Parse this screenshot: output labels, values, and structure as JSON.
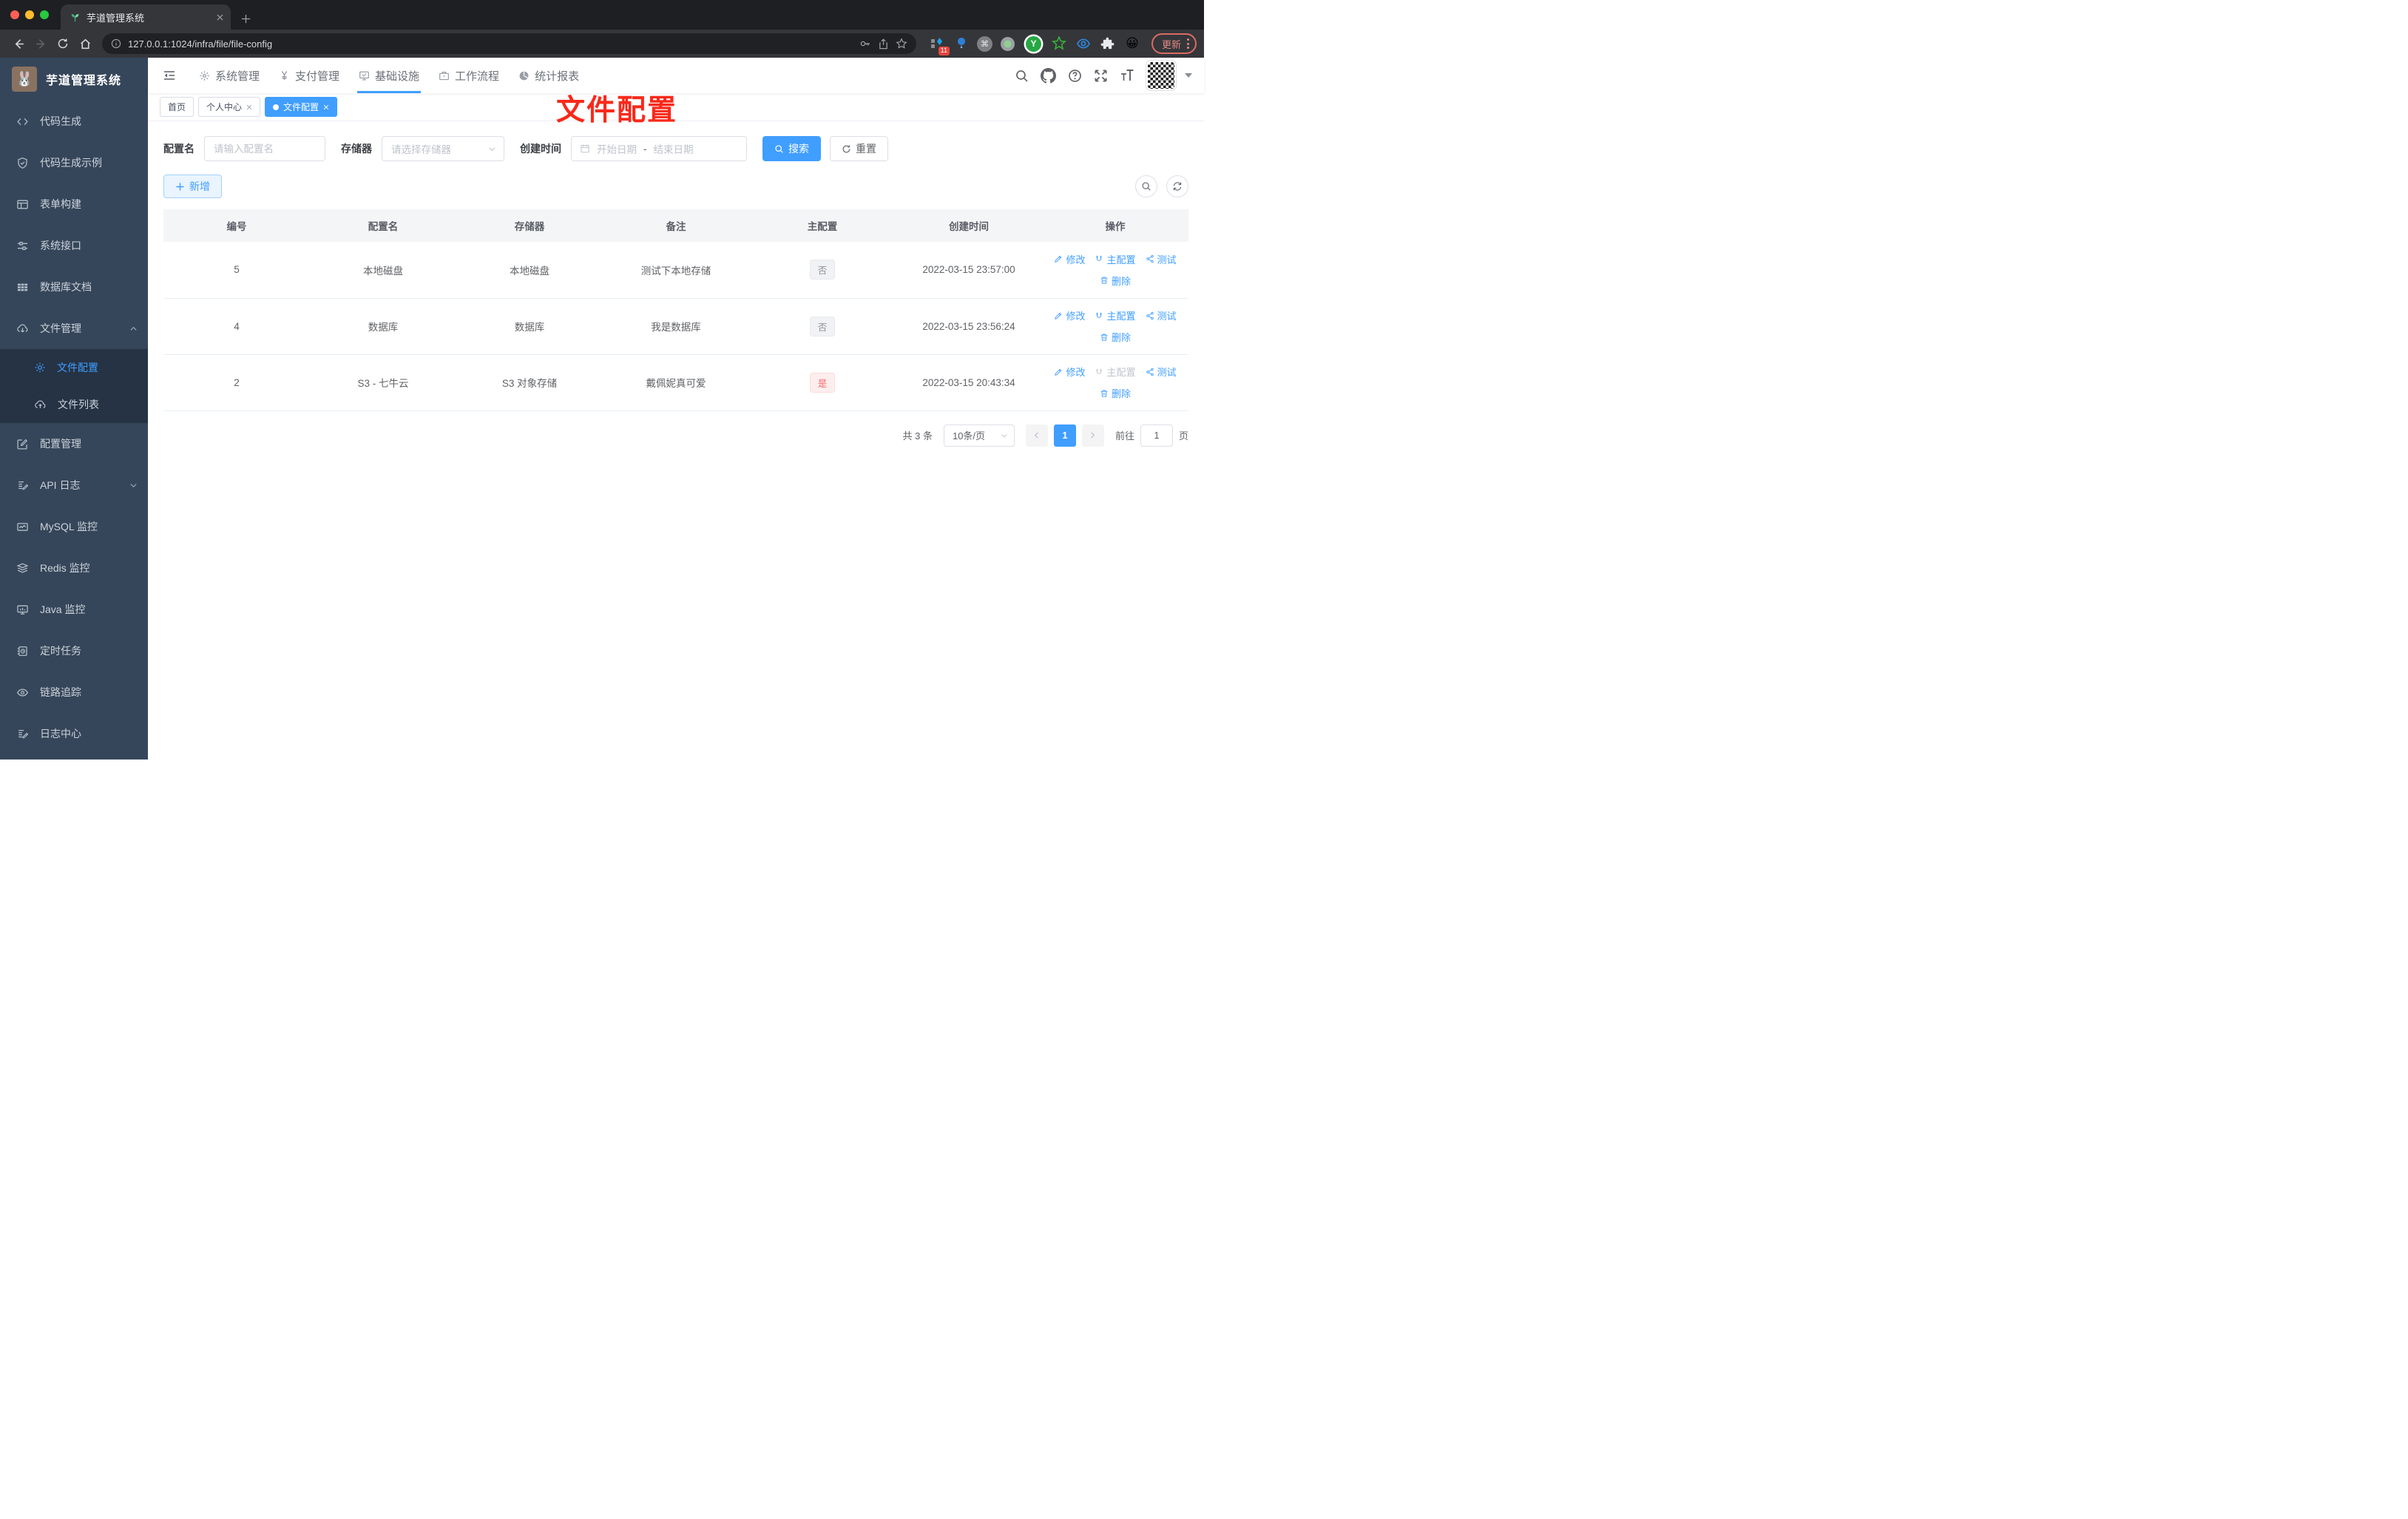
{
  "browser": {
    "tab_title": "芋道管理系统",
    "url": "127.0.0.1:1024/infra/file/file-config",
    "extension_badge": "11",
    "extension_y_label": "Y",
    "extension_emoji": "😀",
    "update_label": "更新"
  },
  "sidebar": {
    "title": "芋道管理系统",
    "logo_emoji": "🐰",
    "items": [
      {
        "label": "代码生成",
        "icon": "code-icon"
      },
      {
        "label": "代码生成示例",
        "icon": "shield-check-icon"
      },
      {
        "label": "表单构建",
        "icon": "form-icon"
      },
      {
        "label": "系统接口",
        "icon": "sliders-icon"
      },
      {
        "label": "数据库文档",
        "icon": "table-grid-icon"
      },
      {
        "label": "文件管理",
        "icon": "cloud-download-icon",
        "expanded": true
      }
    ],
    "submenu": [
      {
        "label": "文件配置",
        "icon": "gear-icon",
        "active": true
      },
      {
        "label": "文件列表",
        "icon": "cloud-upload-icon"
      }
    ],
    "items_bottom": [
      {
        "label": "配置管理",
        "icon": "edit-square-icon"
      },
      {
        "label": "API 日志",
        "icon": "doc-edit-icon",
        "collapsed": true
      },
      {
        "label": "MySQL 监控",
        "icon": "chart-monitor-icon"
      },
      {
        "label": "Redis 监控",
        "icon": "layers-icon"
      },
      {
        "label": "Java 监控",
        "icon": "display-icon"
      },
      {
        "label": "定时任务",
        "icon": "schedule-icon"
      },
      {
        "label": "链路追踪",
        "icon": "eye-icon"
      },
      {
        "label": "日志中心",
        "icon": "doc-edit-icon"
      }
    ]
  },
  "header": {
    "nav": [
      {
        "label": "系统管理",
        "icon": "gear-icon"
      },
      {
        "label": "支付管理",
        "icon": "yen-icon"
      },
      {
        "label": "基础设施",
        "icon": "monitor-check-icon",
        "active": true
      },
      {
        "label": "工作流程",
        "icon": "briefcase-icon"
      },
      {
        "label": "统计报表",
        "icon": "pie-chart-icon"
      }
    ]
  },
  "tags": [
    {
      "label": "首页",
      "closable": false,
      "active": false
    },
    {
      "label": "个人中心",
      "closable": true,
      "active": false
    },
    {
      "label": "文件配置",
      "closable": true,
      "active": true
    }
  ],
  "annotation": {
    "text": "文件配置",
    "color": "#f8291a"
  },
  "filter": {
    "name_label": "配置名",
    "name_placeholder": "请输入配置名",
    "storage_label": "存储器",
    "storage_placeholder": "请选择存储器",
    "date_label": "创建时间",
    "date_start_placeholder": "开始日期",
    "date_separator": "-",
    "date_end_placeholder": "结束日期",
    "search_label": "搜索",
    "reset_label": "重置"
  },
  "toolbar": {
    "add_label": "新增"
  },
  "table": {
    "headers": [
      "编号",
      "配置名",
      "存储器",
      "备注",
      "主配置",
      "创建时间",
      "操作"
    ],
    "actions": {
      "edit": "修改",
      "master": "主配置",
      "test": "测试",
      "delete": "删除"
    },
    "rows": [
      {
        "id": "5",
        "name": "本地磁盘",
        "storage": "本地磁盘",
        "remark": "测试下本地存储",
        "master": "否",
        "master_type": "info",
        "master_disabled": false,
        "created": "2022-03-15 23:57:00"
      },
      {
        "id": "4",
        "name": "数据库",
        "storage": "数据库",
        "remark": "我是数据库",
        "master": "否",
        "master_type": "info",
        "master_disabled": false,
        "created": "2022-03-15 23:56:24"
      },
      {
        "id": "2",
        "name": "S3 - 七牛云",
        "storage": "S3 对象存储",
        "remark": "戴佩妮真可爱",
        "master": "是",
        "master_type": "danger",
        "master_disabled": true,
        "created": "2022-03-15 20:43:34"
      }
    ]
  },
  "pagination": {
    "total_text": "共 3 条",
    "page_size_text": "10条/页",
    "current_page": "1",
    "goto_label": "前往",
    "goto_value": "1",
    "page_unit": "页"
  },
  "colors": {
    "accent": "#409eff",
    "annotation": "#f8291a",
    "sidebar_bg": "#36465a",
    "submenu_bg": "#253344"
  }
}
